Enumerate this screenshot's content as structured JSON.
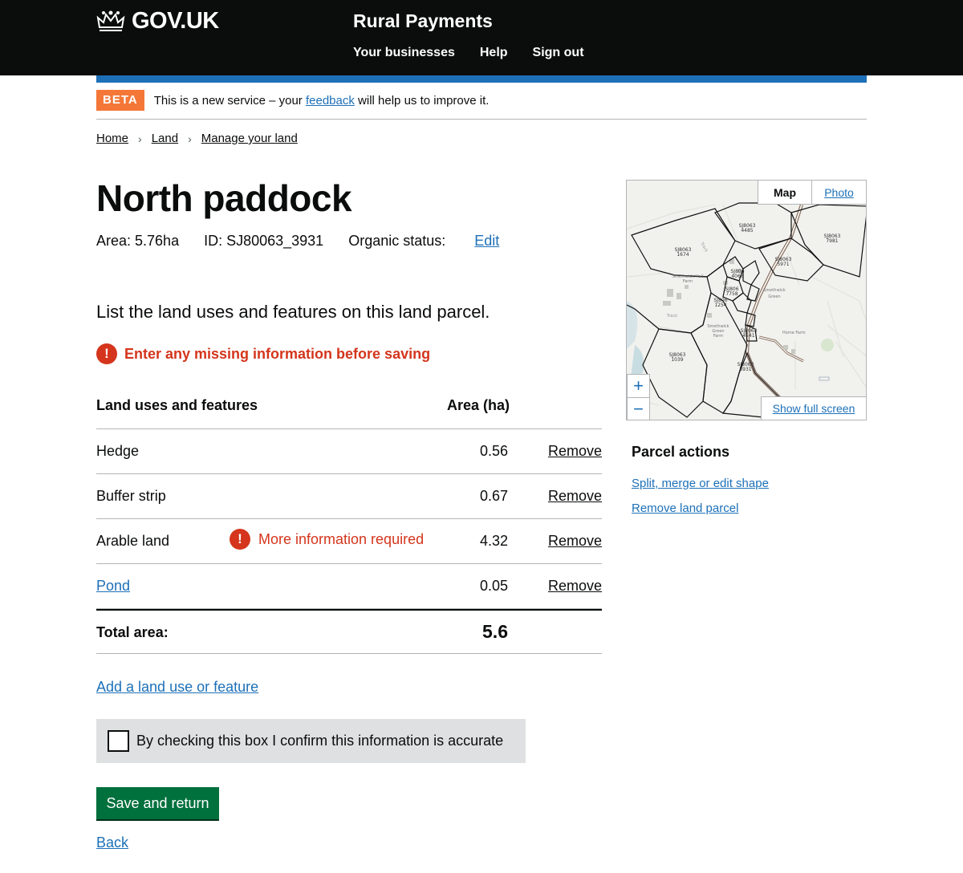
{
  "header": {
    "logo_text": "GOV.UK",
    "service_name": "Rural Payments",
    "nav": [
      "Your businesses",
      "Help",
      "Sign out"
    ]
  },
  "phase_banner": {
    "tag": "BETA",
    "text_before": "This is a new service – your",
    "link": "feedback",
    "text_after": "will help us to improve it."
  },
  "breadcrumbs": [
    "Home",
    "Land",
    "Manage your land"
  ],
  "parcel": {
    "title": "North paddock",
    "area": "Area: 5.76ha",
    "id": "ID: SJ80063_3931",
    "organic_label": "Organic status:",
    "organic_link": "Edit"
  },
  "intro": "List the land uses and features on this land parcel.",
  "error_summary": {
    "icon": "!",
    "message": "Enter any missing information before saving"
  },
  "table": {
    "headers": [
      "Land uses and features",
      "Area (ha)"
    ],
    "rows": [
      {
        "name": "Hedge",
        "area": "0.56",
        "action": "Remove"
      },
      {
        "name": "Buffer strip",
        "area": "0.67",
        "action": "Remove"
      },
      {
        "name": "Arable land",
        "warning": "More information required",
        "area": "4.32",
        "action": "Remove"
      },
      {
        "name": "Pond",
        "area": "0.05",
        "action": "Remove"
      }
    ],
    "total_label": "Total area:",
    "total_value": "5.6"
  },
  "add_link": "Add a land use or feature",
  "confirm_text": "By checking this box I confirm this information is accurate",
  "save_button": "Save and return",
  "back_link": "Back",
  "map": {
    "tabs": [
      "Map",
      "Photo"
    ],
    "zoom_in": "+",
    "zoom_out": "−",
    "fullscreen": "Show full screen",
    "labels": {
      "p4485": [
        "SJ8063",
        "4485"
      ],
      "p7981": [
        "SJ8063",
        "7981"
      ],
      "p1674": [
        "SJ8063",
        "1674"
      ],
      "p5971": [
        "SJ8063",
        "5971"
      ],
      "p1039": [
        "SJ8063",
        "1039"
      ],
      "p3931": [
        "SJ8063",
        "3931"
      ],
      "p1254": [
        "SJ806",
        "1254"
      ],
      "p4068": [
        "SJ806",
        "4068"
      ],
      "p7758": [
        "SJ806",
        "7758"
      ],
      "p4541": [
        "SJ8063",
        "4541"
      ],
      "smeth_hall": [
        "Smethwick Hall",
        "Farm"
      ],
      "smeth_green": [
        "Smethwick",
        "Green"
      ],
      "smeth_green_farm": [
        "Smethwick",
        "Green",
        "Farm"
      ],
      "home_farm": "Home Farm",
      "track1": "Track",
      "track2": "Track"
    }
  },
  "parcel_actions": {
    "title": "Parcel actions",
    "links": [
      "Split, merge or edit shape",
      "Remove land parcel"
    ]
  }
}
